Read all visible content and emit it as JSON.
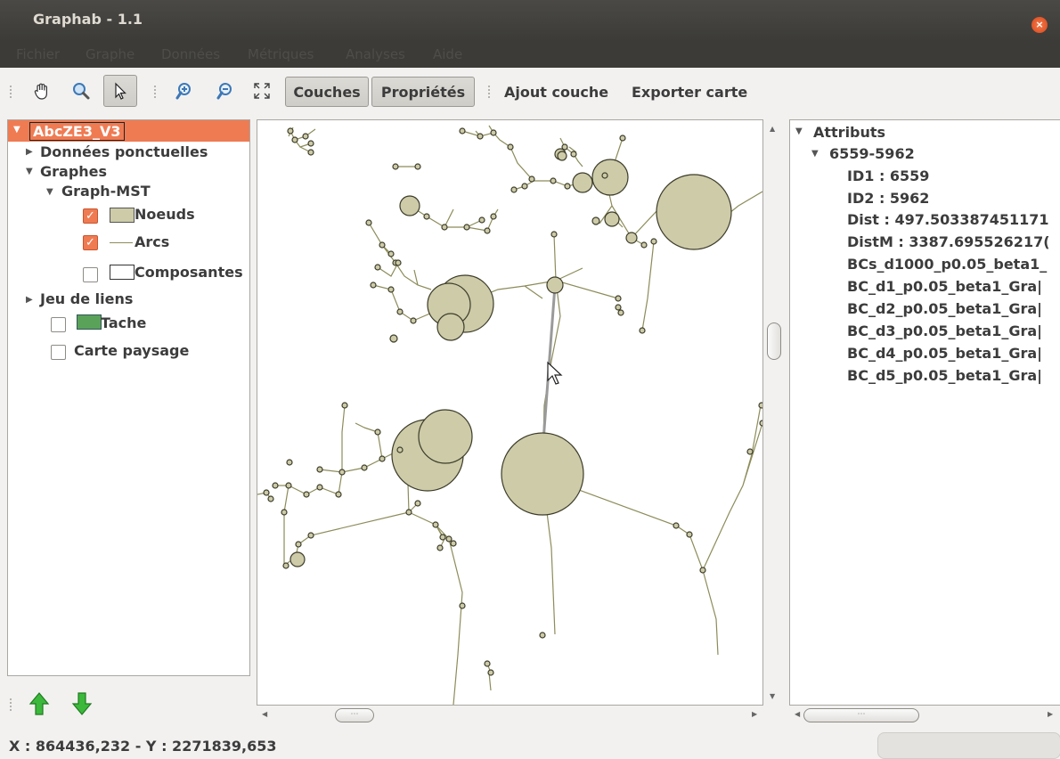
{
  "window": {
    "title": "Graphab - 1.1"
  },
  "menu": [
    "Fichier",
    "Graphe",
    "Données",
    "Métriques",
    "Analyses",
    "Aide"
  ],
  "toolbar": {
    "tab_layers": "Couches",
    "tab_properties": "Propriétés",
    "add_layer": "Ajout couche",
    "export_map": "Exporter carte"
  },
  "layers": {
    "root": "AbcZE3_V3",
    "point_data": "Données ponctuelles",
    "graphs": "Graphes",
    "graph_mst": "Graph-MST",
    "nodes": "Noeuds",
    "arcs": "Arcs",
    "components": "Composantes",
    "links": "Jeu de liens",
    "patch": "Tache",
    "landscape": "Carte paysage"
  },
  "attributes": {
    "header": "Attributs",
    "item": "6559-5962",
    "rows": [
      "ID1 : 6559",
      "ID2 : 5962",
      "Dist : 497.503387451171",
      "DistM : 3387.695526217(",
      "BCs_d1000_p0.05_beta1_",
      "BC_d1_p0.05_beta1_Gra|",
      "BC_d2_p0.05_beta1_Gra|",
      "BC_d3_p0.05_beta1_Gra|",
      "BC_d4_p0.05_beta1_Gra|",
      "BC_d5_p0.05_beta1_Gra|"
    ]
  },
  "status": {
    "coords": "X : 864436,232 - Y : 2271839,653"
  },
  "colors": {
    "node_fill": "#cdcba8",
    "edge": "#8c8c5a",
    "selected": "#ef7b53"
  }
}
